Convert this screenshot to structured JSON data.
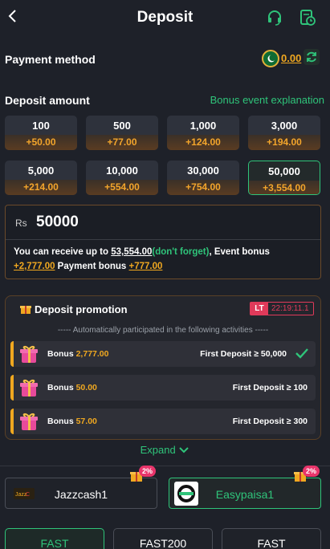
{
  "header": {
    "title": "Deposit"
  },
  "payment_method": {
    "label": "Payment method",
    "balance": "0.00"
  },
  "deposit_amount": {
    "label": "Deposit amount",
    "bonus_link": "Bonus event explanation"
  },
  "amounts": [
    {
      "value": "100",
      "bonus": "+50.00"
    },
    {
      "value": "500",
      "bonus": "+77.00"
    },
    {
      "value": "1,000",
      "bonus": "+124.00"
    },
    {
      "value": "3,000",
      "bonus": "+194.00"
    },
    {
      "value": "5,000",
      "bonus": "+214.00"
    },
    {
      "value": "10,000",
      "bonus": "+554.00"
    },
    {
      "value": "30,000",
      "bonus": "+754.00"
    },
    {
      "value": "50,000",
      "bonus": "+3,554.00"
    }
  ],
  "input": {
    "currency": "Rs",
    "value": "50000"
  },
  "info": {
    "p1": "You can receive up to ",
    "total": "53,554.00",
    "note": "(don't forget)",
    "p2": ", Event bonus",
    "event_bonus": "+2,777.00",
    "p3": " Payment bonus ",
    "payment_bonus": "+777.00"
  },
  "promotion": {
    "title": "Deposit promotion",
    "lt_label": "LT",
    "timer": "22:19:11.1",
    "subtitle": "----- Automatically participated in the following activities -----",
    "rows": [
      {
        "label": "Bonus",
        "value": "2,777.00",
        "condition": "First Deposit ≥ 50,000"
      },
      {
        "label": "Bonus",
        "value": "50.00",
        "condition": "First Deposit ≥ 100"
      },
      {
        "label": "Bonus",
        "value": "57.00",
        "condition": "First Deposit ≥ 300"
      }
    ]
  },
  "expand_label": "Expand",
  "payments": [
    {
      "name": "Jazzcash1",
      "badge": "2%"
    },
    {
      "name": "Easypaisa1",
      "badge": "2%"
    }
  ],
  "channels": [
    "FAST",
    "FAST200",
    "FAST"
  ],
  "colors": {
    "accent": "#2fc47a",
    "bonus": "#f0a820",
    "bg": "#1e2129"
  }
}
